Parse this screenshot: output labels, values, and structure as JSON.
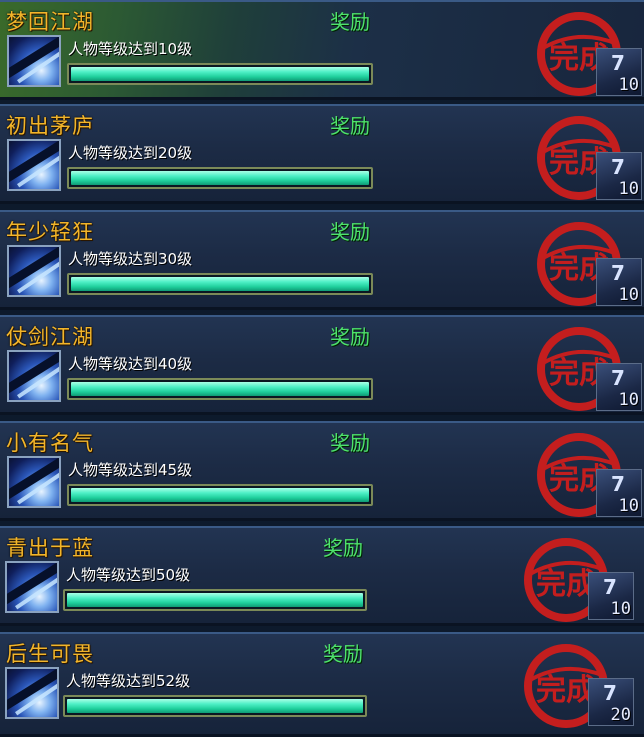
{
  "achievements": [
    {
      "title": "梦回江湖",
      "reward_label": "奖励",
      "description": "人物等级达到10级",
      "progress": 1.0,
      "stamp_text": "完成",
      "reward_count": "10"
    },
    {
      "title": "初出茅庐",
      "reward_label": "奖励",
      "description": "人物等级达到20级",
      "progress": 1.0,
      "stamp_text": "完成",
      "reward_count": "10"
    },
    {
      "title": "年少轻狂",
      "reward_label": "奖励",
      "description": "人物等级达到30级",
      "progress": 1.0,
      "stamp_text": "完成",
      "reward_count": "10"
    },
    {
      "title": "仗剑江湖",
      "reward_label": "奖励",
      "description": "人物等级达到40级",
      "progress": 1.0,
      "stamp_text": "完成",
      "reward_count": "10"
    },
    {
      "title": "小有名气",
      "reward_label": "奖励",
      "description": "人物等级达到45级",
      "progress": 1.0,
      "stamp_text": "完成",
      "reward_count": "10"
    },
    {
      "title": "青出于蓝",
      "reward_label": "奖励",
      "description": "人物等级达到50级",
      "progress": 1.0,
      "stamp_text": "完成",
      "reward_count": "10"
    },
    {
      "title": "后生可畏",
      "reward_label": "奖励",
      "description": "人物等级达到52级",
      "progress": 1.0,
      "stamp_text": "完成",
      "reward_count": "20"
    }
  ],
  "colors": {
    "title": "#f2b52a",
    "reward_label": "#4ee26c",
    "progress_fill": "#34e6b4",
    "stamp": "#c41e1e"
  },
  "icons": {
    "achievement": "sword-slash-icon",
    "reward": "reward-item-icon"
  }
}
